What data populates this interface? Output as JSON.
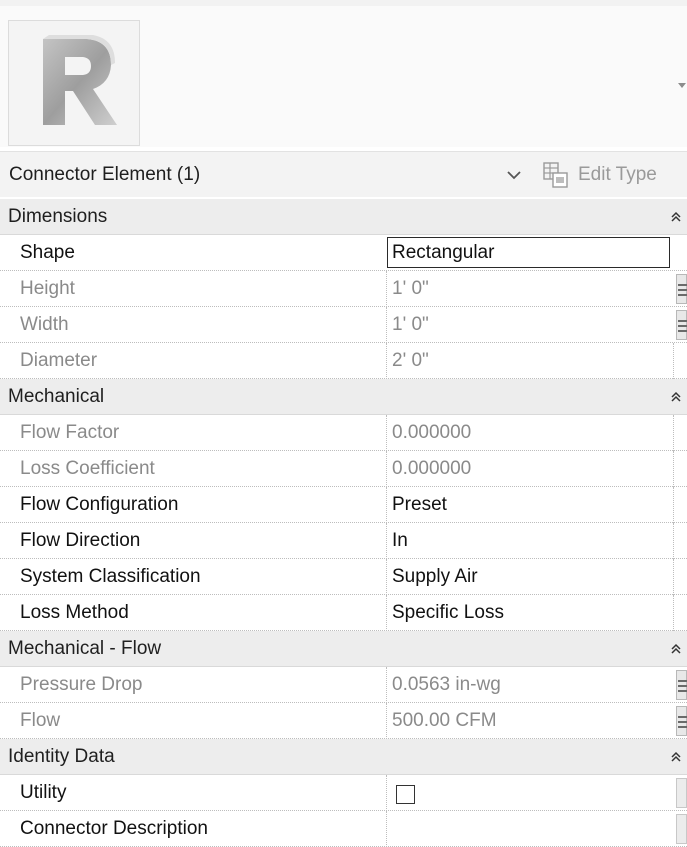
{
  "header": {
    "logo_letter": "R",
    "logo_icon": "revit-logo-icon"
  },
  "selector": {
    "value": "Connector Element (1)",
    "edit_type_label": "Edit Type",
    "edit_type_icon": "edit-type-icon"
  },
  "groups": [
    {
      "label": "Dimensions",
      "rows": [
        {
          "name": "Shape",
          "value": "Rectangular"
        },
        {
          "name": "Height",
          "value": "1'  0\""
        },
        {
          "name": "Width",
          "value": "1'  0\""
        },
        {
          "name": "Diameter",
          "value": "2'  0\""
        }
      ]
    },
    {
      "label": "Mechanical",
      "rows": [
        {
          "name": "Flow Factor",
          "value": "0.000000"
        },
        {
          "name": "Loss Coefficient",
          "value": "0.000000"
        },
        {
          "name": "Flow Configuration",
          "value": "Preset"
        },
        {
          "name": "Flow Direction",
          "value": "In"
        },
        {
          "name": "System Classification",
          "value": "Supply Air"
        },
        {
          "name": "Loss Method",
          "value": "Specific Loss"
        }
      ]
    },
    {
      "label": "Mechanical - Flow",
      "rows": [
        {
          "name": "Pressure Drop",
          "value": "0.0563 in-wg"
        },
        {
          "name": "Flow",
          "value": "500.00 CFM"
        }
      ]
    },
    {
      "label": "Identity Data",
      "rows": [
        {
          "name": "Utility",
          "value": "",
          "checked": false
        },
        {
          "name": "Connector Description",
          "value": ""
        }
      ]
    }
  ]
}
